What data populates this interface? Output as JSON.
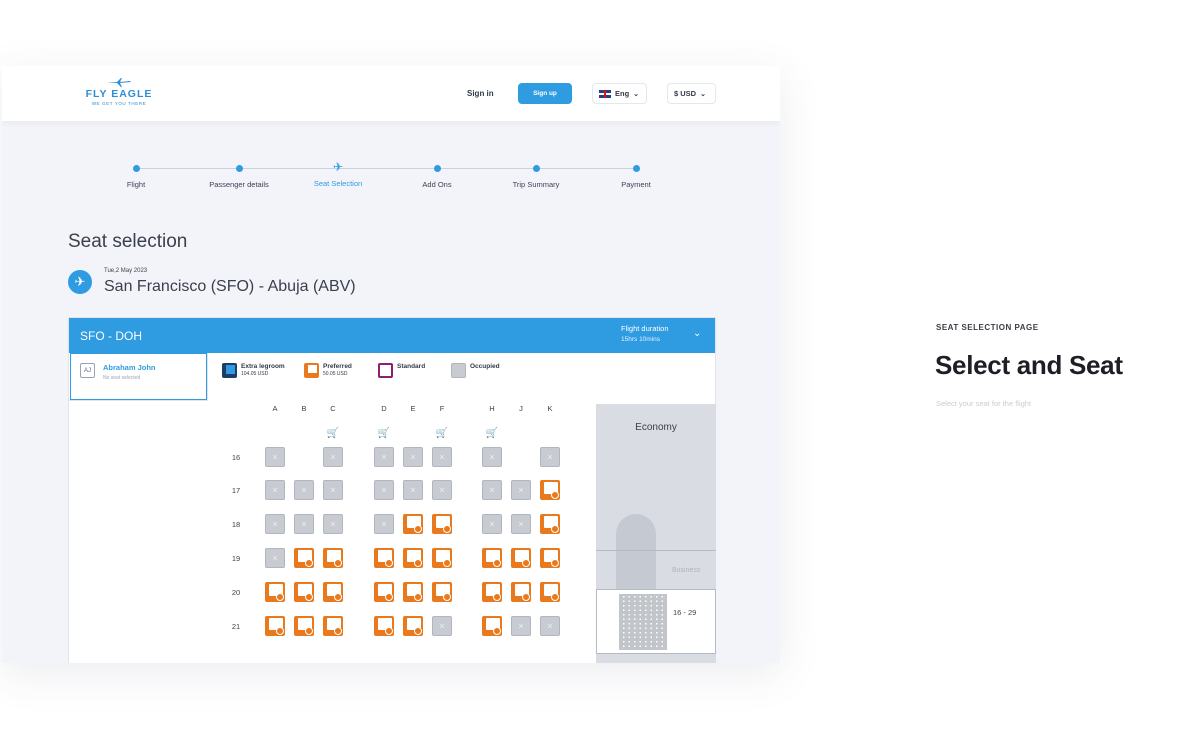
{
  "brand": {
    "name": "FLY EAGLE",
    "tagline": "WE GET YOU THERE",
    "color": "#2f8ed3"
  },
  "topbar": {
    "sign_in": "Sign in",
    "sign_up": "Sign up",
    "language": "Eng",
    "currency": "$ USD"
  },
  "steps": [
    {
      "label": "Flight"
    },
    {
      "label": "Passenger details"
    },
    {
      "label": "Seat Selection",
      "active": true
    },
    {
      "label": "Add Ons"
    },
    {
      "label": "Trip Summary"
    },
    {
      "label": "Payment"
    }
  ],
  "page": {
    "title": "Seat selection",
    "date": "Tue,2 May 2023",
    "route": "San Francisco (SFO)  -  Abuja (ABV)"
  },
  "panel": {
    "leg": "SFO - DOH",
    "duration_label": "Flight duration",
    "duration_value": "15hrs 10mins"
  },
  "passenger": {
    "initials": "AJ",
    "name": "Abraham John",
    "status": "No seat selected"
  },
  "legend": [
    {
      "type": "extra",
      "label": "Extra legroom",
      "price": "104.05 USD"
    },
    {
      "type": "pref",
      "label": "Preferred",
      "price": "50.05 USD"
    },
    {
      "type": "std",
      "label": "Standard",
      "price": ""
    },
    {
      "type": "occ",
      "label": "Occupied",
      "price": ""
    }
  ],
  "columns": [
    "A",
    "B",
    "C",
    "D",
    "E",
    "F",
    "H",
    "J",
    "K"
  ],
  "rows": [
    {
      "num": "16",
      "seats": [
        "occ",
        "",
        "occ",
        "occ",
        "occ",
        "occ",
        "occ",
        "",
        "occ"
      ]
    },
    {
      "num": "17",
      "seats": [
        "occ",
        "occ",
        "occ",
        "occ",
        "occ",
        "occ",
        "occ",
        "occ",
        "pref"
      ]
    },
    {
      "num": "18",
      "seats": [
        "occ",
        "occ",
        "occ",
        "occ",
        "pref",
        "pref",
        "occ",
        "occ",
        "pref"
      ]
    },
    {
      "num": "19",
      "seats": [
        "occ",
        "pref",
        "pref",
        "pref",
        "pref",
        "pref",
        "pref",
        "pref",
        "pref"
      ]
    },
    {
      "num": "20",
      "seats": [
        "pref",
        "pref",
        "pref",
        "pref",
        "pref",
        "pref",
        "pref",
        "pref",
        "pref"
      ]
    },
    {
      "num": "21",
      "seats": [
        "pref",
        "pref",
        "pref",
        "pref",
        "pref",
        "occ",
        "pref",
        "occ",
        "occ"
      ]
    }
  ],
  "strollers": [
    "C",
    "D",
    "F",
    "H"
  ],
  "seatmap": {
    "cabin": "Economy",
    "business": "Business",
    "range": "16 - 29"
  },
  "promo": {
    "eyebrow": "SEAT SELECTION PAGE",
    "title": "Select and Seat",
    "subtitle": "Select your seat for the flight"
  },
  "colors": {
    "primary": "#2f9be0",
    "preferred": "#e87a1d",
    "occupied": "#c8cbd1",
    "standard": "#8e1f6e",
    "extra": "#1f3b66"
  }
}
